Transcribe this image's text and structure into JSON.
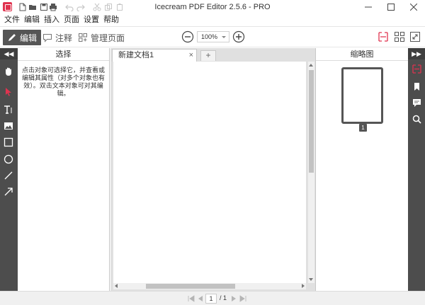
{
  "window": {
    "title": "Icecream PDF Editor 2.5.6 - PRO"
  },
  "colors": {
    "accent": "#e0334f",
    "dark_strip": "#4d4d4d",
    "active_mode_bg": "#555555"
  },
  "quick_access": [
    {
      "icon": "new-file-icon"
    },
    {
      "icon": "open-folder-icon"
    },
    {
      "icon": "save-icon"
    },
    {
      "icon": "print-icon"
    },
    {
      "icon": "undo-icon"
    },
    {
      "icon": "redo-icon"
    },
    {
      "icon": "cut-icon"
    },
    {
      "icon": "copy-icon"
    },
    {
      "icon": "paste-icon"
    }
  ],
  "menu": {
    "items": [
      "文件",
      "编辑",
      "插入",
      "页面",
      "设置",
      "帮助"
    ]
  },
  "toolbar": {
    "edit_label": "编辑",
    "annotate_label": "注释",
    "manage_label": "管理页面",
    "zoom_value": "100%"
  },
  "left_tools": [
    {
      "icon": "hand-icon"
    },
    {
      "icon": "select-arrow-icon",
      "active": true
    },
    {
      "icon": "text-tool-icon"
    },
    {
      "icon": "image-tool-icon"
    },
    {
      "icon": "rectangle-tool-icon"
    },
    {
      "icon": "ellipse-tool-icon"
    },
    {
      "icon": "line-tool-icon"
    },
    {
      "icon": "arrow-tool-icon"
    }
  ],
  "left_panel": {
    "title": "选择",
    "description": "点击对象可选择它，并查看或编辑其属性（对多个对象也有效）。双击文本对象可对其编辑。"
  },
  "document": {
    "tab_label": "新建文档1",
    "tab_close": "×",
    "add_tab": "+"
  },
  "thumbnail_panel": {
    "title": "缩略图",
    "page_number": "1"
  },
  "right_tools": [
    {
      "icon": "page-view-icon",
      "active": true
    },
    {
      "icon": "bookmark-icon"
    },
    {
      "icon": "comment-icon"
    },
    {
      "icon": "search-icon"
    }
  ],
  "statusbar": {
    "current_page": "1",
    "total_pages": "/ 1"
  }
}
